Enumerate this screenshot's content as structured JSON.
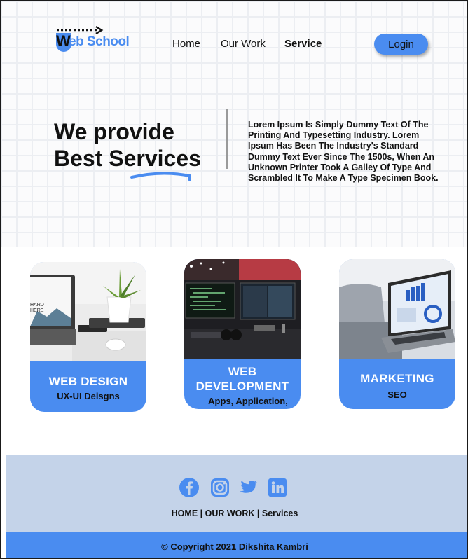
{
  "brand": {
    "name": "Web School",
    "logo_letter": "W",
    "accent": "#4a8cf0"
  },
  "nav": {
    "items": [
      {
        "label": "Home",
        "active": false
      },
      {
        "label": "Our Work",
        "active": false
      },
      {
        "label": "Service",
        "active": true
      }
    ],
    "login_label": "Login"
  },
  "hero": {
    "title_line1": "We provide",
    "title_line2": "Best Services",
    "description": "Lorem Ipsum Is Simply Dummy Text Of The Printing And Typesetting Industry. Lorem Ipsum Has Been The Industry's Standard Dummy Text Ever Since The 1500s, When An Unknown Printer Took A Galley Of Type And Scrambled It To Make A Type Specimen Book."
  },
  "services": [
    {
      "title": "WEB DESIGN",
      "subtitle": "UX-UI Deisgns",
      "image_text": "HARD HERE"
    },
    {
      "title_line1": "WEB",
      "title_line2": "DEVELOPMENT",
      "subtitle": "Apps, Application,"
    },
    {
      "title": "MARKETING",
      "subtitle": "SEO"
    }
  ],
  "footer": {
    "social_icons": [
      "facebook-icon",
      "instagram-icon",
      "twitter-icon",
      "linkedin-icon"
    ],
    "links": [
      "HOME",
      "OUR WORK",
      "Services"
    ],
    "separator": " | ",
    "copyright": "© Copyright 2021 Dikshita Kambri"
  }
}
